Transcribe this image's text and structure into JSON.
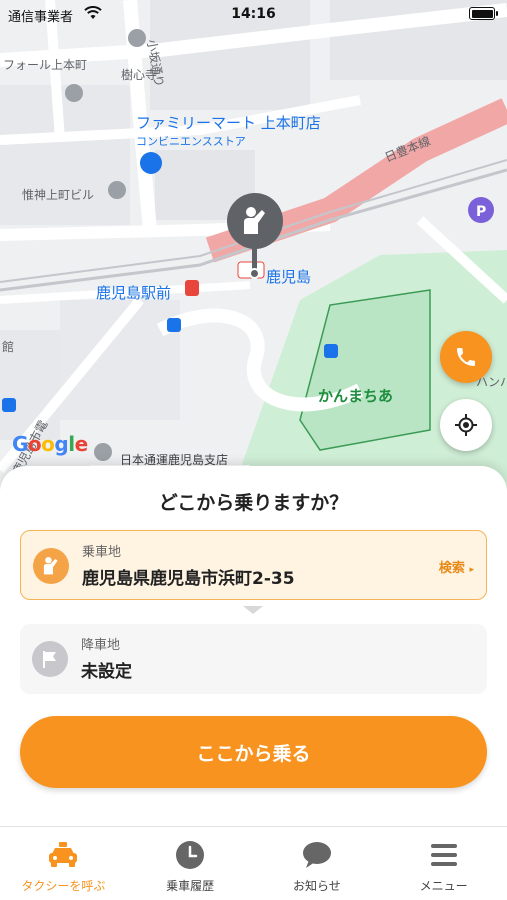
{
  "status_bar": {
    "carrier": "通信事業者",
    "time": "14:16"
  },
  "map": {
    "labels": {
      "forel": "フォール上本町",
      "jushinji": "樹心寺",
      "kosaka_dori": "小坂通り",
      "familymart": "ファミリーマート 上本町店",
      "convenience": "コンビニエンスストア",
      "nippo_line": "日豊本線",
      "ishin_building": "惟神上町ビル",
      "kagoshima": "鹿児島",
      "kagoshima_ekimae": "鹿児島駅前",
      "kan": "館",
      "kanmachia": "かんまちあ",
      "hanbe": "ハンバ",
      "nittsu": "日本通運鹿児島支店",
      "kagoshima_shiden": "鹿児島市電"
    },
    "google_logo_letters": [
      "G",
      "o",
      "o",
      "g",
      "l",
      "e"
    ],
    "colors": {
      "railway": "#f2a7a7",
      "park": "#cfeed6",
      "road": "#ffffff",
      "pin": "#5f6368"
    }
  },
  "fab": {
    "phone_icon": "phone-icon",
    "locate_icon": "crosshair-icon",
    "accent": "#f7931e"
  },
  "sheet": {
    "title": "どこから乗りますか？",
    "pickup": {
      "label": "乗車地",
      "value": "鹿児島県鹿児島市浜町2-35",
      "search": "検索",
      "icon": "hailing-person-icon"
    },
    "dropoff": {
      "label": "降車地",
      "value": "未設定",
      "icon": "flag-icon"
    },
    "ride_button": "ここから乗る"
  },
  "tabbar": {
    "items": [
      {
        "label": "タクシーを呼ぶ",
        "icon": "taxi-icon",
        "active": true
      },
      {
        "label": "乗車履歴",
        "icon": "clock-icon",
        "active": false
      },
      {
        "label": "お知らせ",
        "icon": "chat-bubble-icon",
        "active": false
      },
      {
        "label": "メニュー",
        "icon": "hamburger-menu-icon",
        "active": false
      }
    ]
  }
}
